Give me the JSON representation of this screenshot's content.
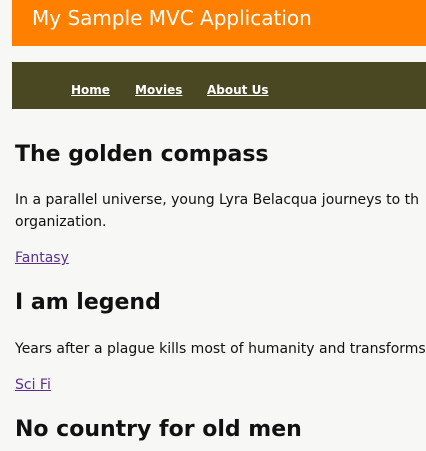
{
  "header": {
    "title": "My Sample MVC Application"
  },
  "nav": {
    "items": [
      {
        "label": "Home"
      },
      {
        "label": "Movies"
      },
      {
        "label": "About Us"
      }
    ]
  },
  "movies": [
    {
      "title": "The golden compass",
      "description": "In a parallel universe, young Lyra Belacqua journeys to th organization.",
      "description_line1": "In a parallel universe, young Lyra Belacqua journeys to th",
      "description_line2": "organization.",
      "genre": "Fantasy"
    },
    {
      "title": "I am legend",
      "description_line1": "Years after a plague kills most of humanity and transforms",
      "genre": "Sci Fi"
    },
    {
      "title": "No country for old men"
    }
  ],
  "colors": {
    "header_bg": "#ff7f00",
    "nav_bg": "#4a4822",
    "page_bg": "#f7f7f5",
    "link": "#5a2f8f"
  }
}
